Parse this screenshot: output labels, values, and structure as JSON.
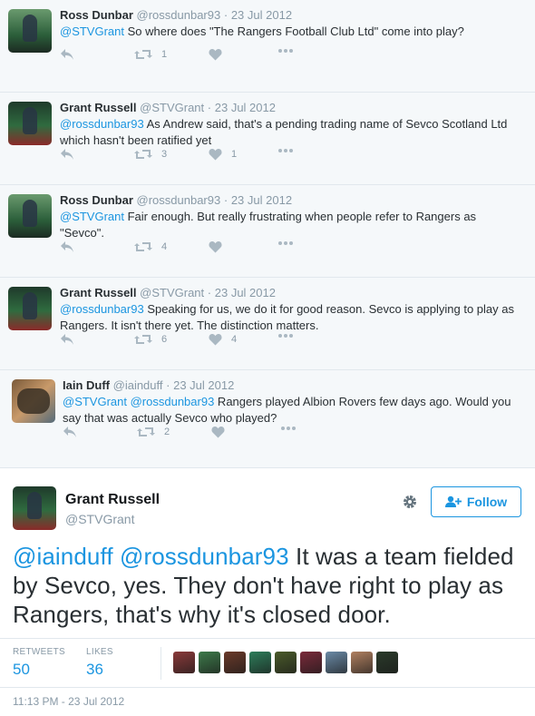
{
  "thread": [
    {
      "name": "Ross Dunbar",
      "handle": "@rossdunbar93",
      "date": "23 Jul 2012",
      "mention": "@STVGrant",
      "text": " So where does \"The Rangers Football Club Ltd\" come into play?",
      "retweets": "1",
      "likes": ""
    },
    {
      "name": "Grant Russell",
      "handle": "@STVGrant",
      "date": "23 Jul 2012",
      "mention": "@rossdunbar93",
      "text": " As Andrew said, that's a pending trading name of Sevco Scotland Ltd which hasn't been ratified yet",
      "retweets": "3",
      "likes": "1"
    },
    {
      "name": "Ross Dunbar",
      "handle": "@rossdunbar93",
      "date": "23 Jul 2012",
      "mention": "@STVGrant",
      "text": " Fair enough. But really frustrating when people refer to Rangers as \"Sevco\".",
      "retweets": "4",
      "likes": ""
    },
    {
      "name": "Grant Russell",
      "handle": "@STVGrant",
      "date": "23 Jul 2012",
      "mention": "@rossdunbar93",
      "text": " Speaking for us, we do it for good reason. Sevco is applying to play as Rangers. It isn't there yet. The distinction matters.",
      "retweets": "6",
      "likes": "4"
    },
    {
      "name": "Iain Duff",
      "handle": "@iainduff",
      "date": "23 Jul 2012",
      "mention": "@STVGrant @rossdunbar93",
      "text": " Rangers played Albion Rovers  few days ago. Would you say that was actually Sevco who played?",
      "retweets": "2",
      "likes": ""
    }
  ],
  "main": {
    "name": "Grant Russell",
    "handle": "@STVGrant",
    "follow_label": "Follow",
    "mentions": "@iainduff @rossdunbar93",
    "text": " It was a team fielded by Sevco, yes. They don't have right to play as Rangers, that's why it's closed door.",
    "retweets_label": "RETWEETS",
    "retweets": "50",
    "likes_label": "LIKES",
    "likes": "36",
    "timestamp": "11:13 PM - 23 Jul 2012",
    "liker_colors": [
      "#8a3a3a",
      "#3d7a4a",
      "#6a3a2a",
      "#2e7d5a",
      "#4a5a2a",
      "#7a2a3a",
      "#6a8aa6",
      "#b08060",
      "#2a3a2a"
    ]
  },
  "colors": {
    "accent": "#1b95e0",
    "muted": "#8899a6",
    "icon": "#aab8c2"
  }
}
